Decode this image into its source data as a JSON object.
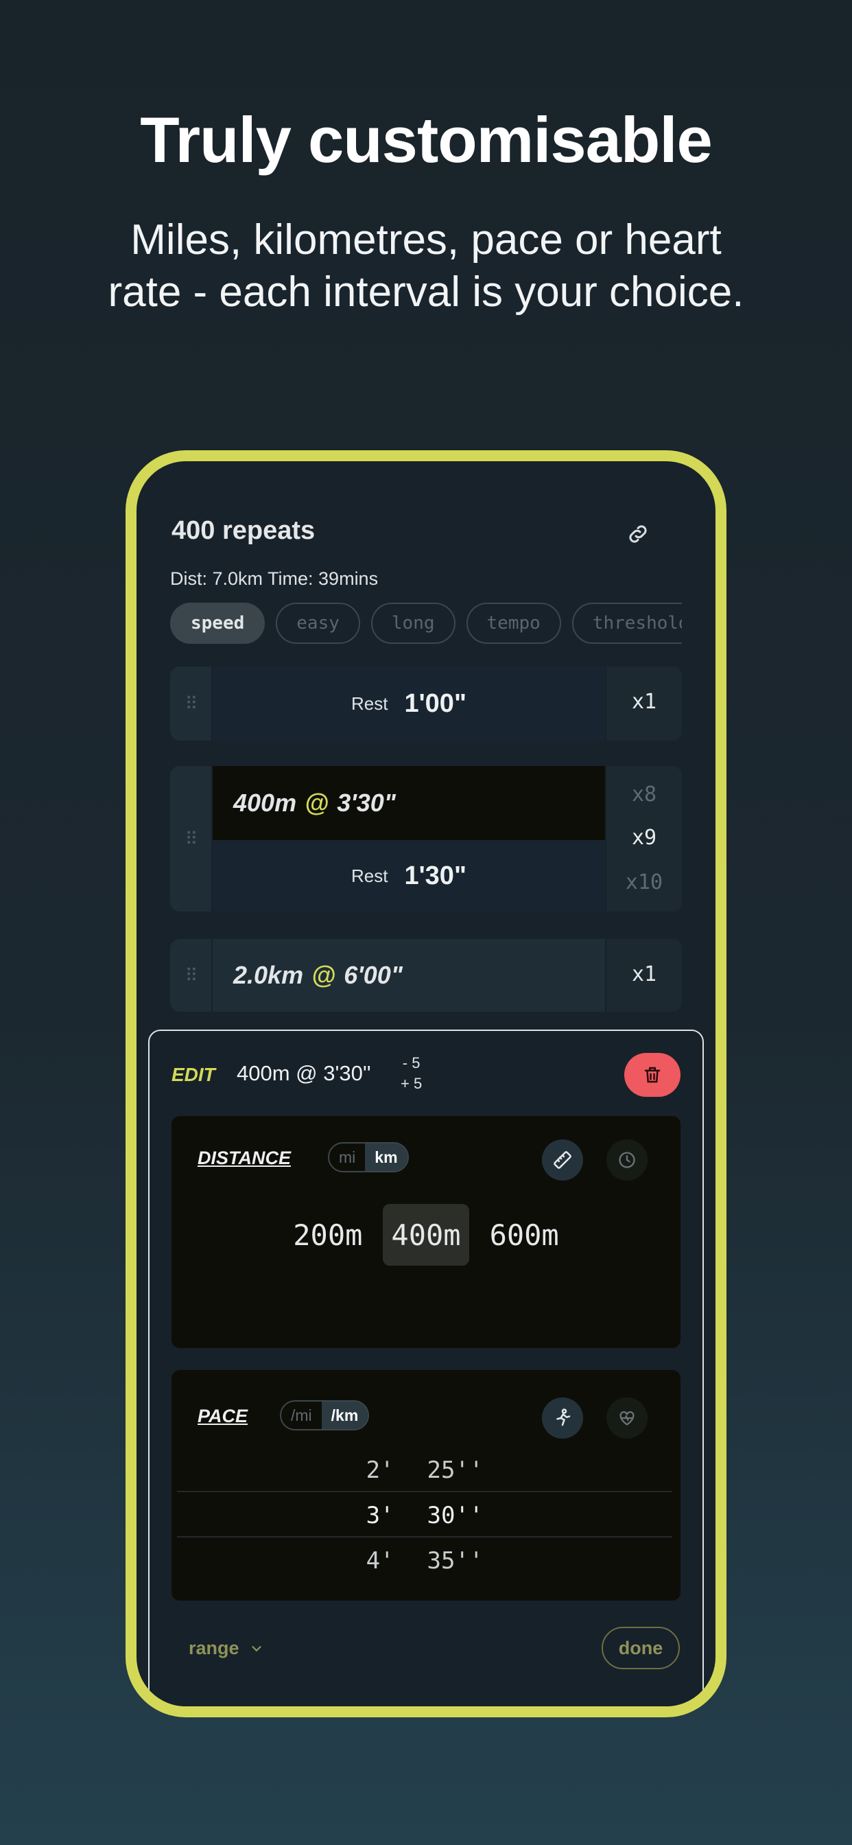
{
  "header": {
    "headline": "Truly customisable",
    "subline_1": "Miles, kilometres, pace or heart",
    "subline_2": "rate - each interval is your choice."
  },
  "workout": {
    "title": "400 repeats",
    "meta": "Dist: 7.0km Time: 39mins",
    "tags": [
      {
        "label": "speed",
        "active": true
      },
      {
        "label": "easy",
        "active": false
      },
      {
        "label": "long",
        "active": false
      },
      {
        "label": "tempo",
        "active": false
      },
      {
        "label": "threshold",
        "active": false
      }
    ]
  },
  "steps": {
    "rest_1": {
      "label": "Rest",
      "value": "1'00\"",
      "multiplier": "x1"
    },
    "repeat_block": {
      "distance": "400m",
      "at": "@",
      "pace": "3'30\"",
      "rest_label": "Rest",
      "rest_value": "1'30\"",
      "multipliers": [
        "x8",
        "x9",
        "x10"
      ]
    },
    "interval_3": {
      "distance": "2.0km",
      "at": "@",
      "pace": "6'00\"",
      "multiplier": "x1"
    }
  },
  "edit": {
    "tag": "EDIT",
    "summary": "400m @ 3'30''",
    "step_down": "- 5",
    "step_up": "+ 5",
    "distance": {
      "label": "DISTANCE",
      "unit_options": [
        "mi",
        "km"
      ],
      "selected_unit": "km",
      "options": [
        "200m",
        "400m",
        "600m"
      ],
      "selected": "400m"
    },
    "pace": {
      "label": "PACE",
      "unit_options": [
        "/mi",
        "/km"
      ],
      "selected_unit": "/km",
      "rows": [
        {
          "min": "2'",
          "sec": "25''"
        },
        {
          "min": "3'",
          "sec": "30''"
        },
        {
          "min": "4'",
          "sec": "35''"
        }
      ]
    },
    "range_label": "range",
    "done_label": "done"
  },
  "colors": {
    "accent": "#d3d957",
    "delete": "#ee5a5f",
    "background": "#19232a"
  }
}
